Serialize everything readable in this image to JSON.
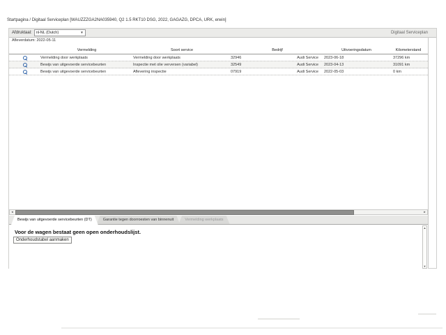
{
  "page": {
    "breadcrumb": "Startpagina / Digitaal Serviceplan [WAUZZZGA2NA035940, Q2 1.5 RKT10 DSG, 2022, GAGAZG, DPCA, URK, erwin]"
  },
  "toolbar": {
    "print_language_label": "Afdruktaal:",
    "print_language_value": "nl-NL (Dutch)",
    "title_right": "Digitaal Serviceplan"
  },
  "subheader": {
    "delivery_line": "Afleverdatum: 2022-05-11"
  },
  "table": {
    "columns": [
      "Vermelding",
      "Soort service",
      "Bedrijf",
      "Uitvoeringsdatum",
      "Kilometerstand"
    ],
    "rows": [
      {
        "vermelding": "Vermelding door werkplaats",
        "soort_service": "Vermelding door werkplaats",
        "bedrijf_nr": "32946",
        "bedrijf_naam": "Audi Service",
        "uitvoeringsdatum": "2023-06-18",
        "kilometerstand": "37296 km"
      },
      {
        "vermelding": "Bewijs van uitgevoerde servicebeurten",
        "soort_service": "Inspectie met olie verversen (variabel)",
        "bedrijf_nr": "32549",
        "bedrijf_naam": "Audi Service",
        "uitvoeringsdatum": "2023-04-13",
        "kilometerstand": "31091 km"
      },
      {
        "vermelding": "Bewijs van uitgevoerde servicebeurten",
        "soort_service": "Aflevering inspectie",
        "bedrijf_nr": "07919",
        "bedrijf_naam": "Audi Service",
        "uitvoeringsdatum": "2022-05-03",
        "kilometerstand": "0 km"
      }
    ]
  },
  "tabs": [
    {
      "label": "Bewijs van uitgevoerde servicebeurten (DT)",
      "active": true
    },
    {
      "label": "Garantie tegen doorroesten van binnenuit",
      "active": false
    },
    {
      "label": "Vermelding werkplaats",
      "active": false,
      "disabled": true
    }
  ],
  "panel": {
    "message": "Voor de wagen bestaat geen open onderhoudslijst.",
    "button_label": "Onderhoudstabel aanmaken"
  },
  "icons": {
    "select_arrow": "▼",
    "scroll_left": "◄",
    "scroll_right": "►",
    "scroll_up": "▲",
    "scroll_down": "▼",
    "row_icon": "magnifier-icon"
  },
  "colors": {
    "icon_blue": "#2f63a8",
    "toolbar_gray": "#ebebe9",
    "tab_inactive_gray": "#d9d9d7",
    "scroll_thumb_gray": "#8f8f8d",
    "row_alt": "#f4f4f2"
  }
}
